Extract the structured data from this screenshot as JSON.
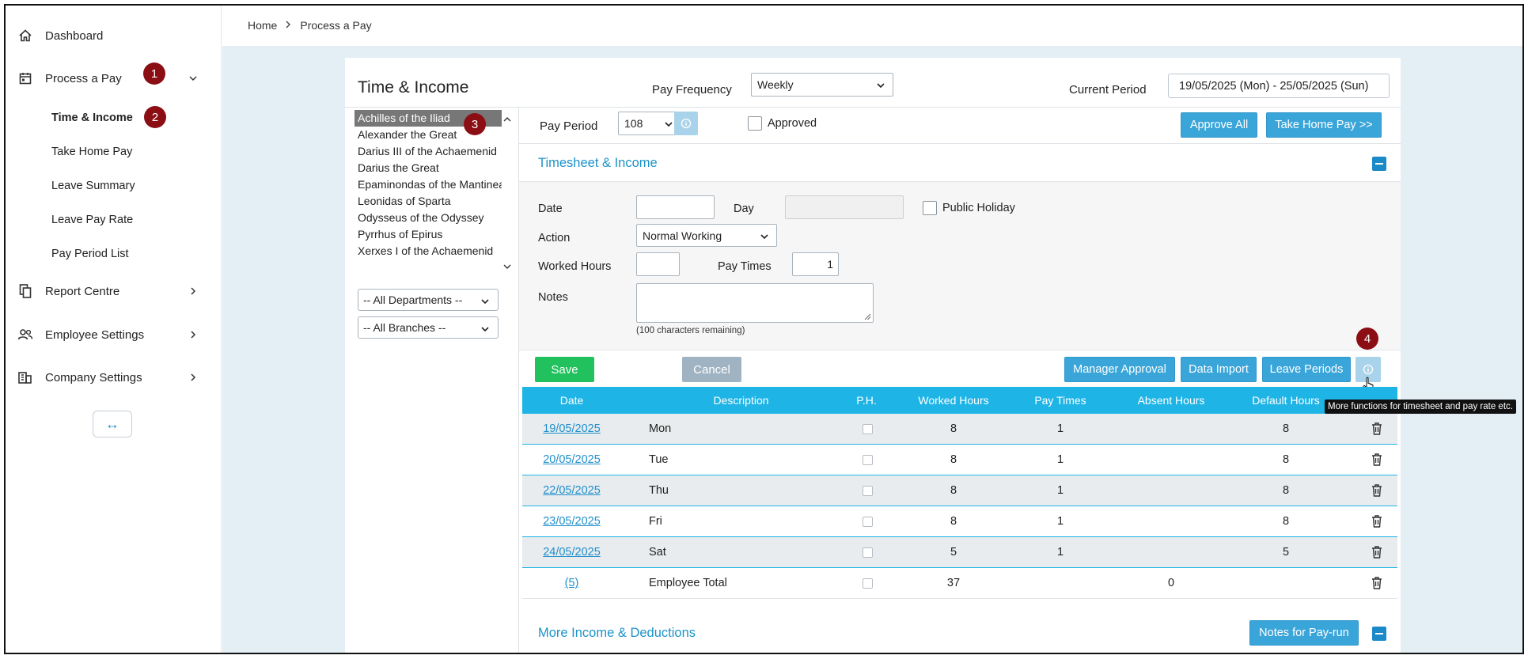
{
  "sidebar": {
    "items": [
      {
        "label": "Dashboard",
        "icon": "home-icon"
      },
      {
        "label": "Process a Pay",
        "icon": "calendar-icon"
      },
      {
        "label": "Report Centre",
        "icon": "report-icon"
      },
      {
        "label": "Employee Settings",
        "icon": "users-icon"
      },
      {
        "label": "Company Settings",
        "icon": "company-icon"
      }
    ],
    "subitems": [
      "Time & Income",
      "Take Home Pay",
      "Leave Summary",
      "Leave Pay Rate",
      "Pay Period List"
    ],
    "collapse_glyph": "↔"
  },
  "badges": [
    "1",
    "2",
    "3",
    "4"
  ],
  "breadcrumb": {
    "home": "Home",
    "current": "Process a Pay"
  },
  "header": {
    "title": "Time & Income",
    "pay_frequency_label": "Pay Frequency",
    "pay_frequency_value": "Weekly",
    "current_period_label": "Current Period",
    "current_period_value": "19/05/2025 (Mon) - 25/05/2025 (Sun)"
  },
  "employees": [
    "Achilles of the Iliad",
    "Alexander the Great",
    "Darius III of the Achaemenid",
    "Darius the Great",
    "Epaminondas of the Mantinea",
    "Leonidas of Sparta",
    "Odysseus of the Odyssey",
    "Pyrrhus of Epirus",
    "Xerxes I of the Achaemenid"
  ],
  "filters": {
    "departments": "-- All Departments --",
    "branches": "-- All Branches --"
  },
  "pay_period": {
    "label": "Pay Period",
    "value": "108",
    "approved_label": "Approved"
  },
  "actions": {
    "approve_all": "Approve All",
    "take_home_pay": "Take Home Pay >>"
  },
  "timesheet": {
    "section_title": "Timesheet & Income",
    "date_label": "Date",
    "day_label": "Day",
    "public_holiday_label": "Public Holiday",
    "action_label": "Action",
    "action_value": "Normal Working",
    "worked_hours_label": "Worked Hours",
    "pay_times_label": "Pay Times",
    "pay_times_value": "1",
    "notes_label": "Notes",
    "notes_remaining": "(100 characters remaining)"
  },
  "buttons": {
    "save": "Save",
    "cancel": "Cancel",
    "manager_approval": "Manager Approval",
    "data_import": "Data Import",
    "leave_periods": "Leave Periods",
    "more_tooltip": "More functions for timesheet and pay rate etc."
  },
  "table": {
    "headers": [
      "Date",
      "Description",
      "P.H.",
      "Worked Hours",
      "Pay Times",
      "Absent Hours",
      "Default Hours"
    ],
    "rows": [
      {
        "date": "19/05/2025",
        "desc": "Mon",
        "worked": "8",
        "pay_times": "1",
        "absent": "",
        "default": "8"
      },
      {
        "date": "20/05/2025",
        "desc": "Tue",
        "worked": "8",
        "pay_times": "1",
        "absent": "",
        "default": "8"
      },
      {
        "date": "22/05/2025",
        "desc": "Thu",
        "worked": "8",
        "pay_times": "1",
        "absent": "",
        "default": "8"
      },
      {
        "date": "23/05/2025",
        "desc": "Fri",
        "worked": "8",
        "pay_times": "1",
        "absent": "",
        "default": "8"
      },
      {
        "date": "24/05/2025",
        "desc": "Sat",
        "worked": "5",
        "pay_times": "1",
        "absent": "",
        "default": "5"
      }
    ],
    "total": {
      "date": "(5)",
      "desc": "Employee Total",
      "worked": "37",
      "pay_times": "",
      "absent": "0",
      "default": ""
    }
  },
  "more_section": {
    "title": "More Income & Deductions",
    "notes_button": "Notes for Pay-run"
  },
  "colors": {
    "accent": "#1fb4e6",
    "button_blue": "#3aa5d9",
    "save_green": "#21c15e",
    "badge_red": "#8b0e15",
    "link_blue": "#1f8fcc"
  }
}
